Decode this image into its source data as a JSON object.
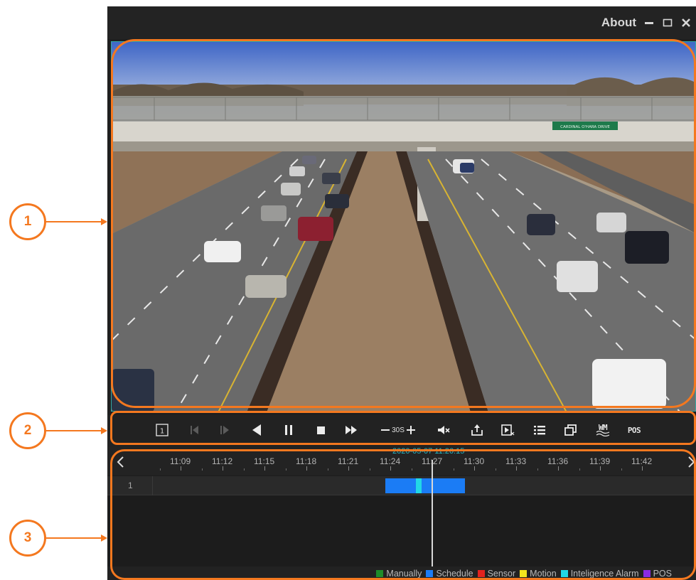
{
  "window": {
    "about_label": "About",
    "controls": [
      "minimize-icon",
      "maximize-icon",
      "close-icon"
    ]
  },
  "video": {
    "sign_text": "CARDINAL O'HARA DRIVE"
  },
  "toolbar": {
    "buttons": [
      {
        "name": "single-window-icon",
        "glyph": "1"
      },
      {
        "name": "frame-back-icon"
      },
      {
        "name": "frame-forward-icon"
      },
      {
        "name": "reverse-play-icon"
      },
      {
        "name": "pause-icon"
      },
      {
        "name": "stop-icon"
      },
      {
        "name": "fast-forward-icon"
      },
      {
        "name": "speed-minus-icon"
      },
      {
        "name": "speed-plus-icon"
      },
      {
        "name": "mute-icon"
      },
      {
        "name": "export-icon"
      },
      {
        "name": "clip-icon"
      },
      {
        "name": "list-icon"
      },
      {
        "name": "window-layout-icon"
      },
      {
        "name": "watermark-icon"
      },
      {
        "name": "pos-icon"
      }
    ],
    "speed_value": "30S",
    "watermark_text": "WM",
    "pos_text": "POS"
  },
  "timeline": {
    "current_time": "2020-05-07 11:26:15",
    "ticks": [
      "11:09",
      "11:12",
      "11:15",
      "11:18",
      "11:21",
      "11:24",
      "11:27",
      "11:30",
      "11:33",
      "11:36",
      "11:39",
      "11:42"
    ],
    "channel": "1",
    "recordings": [
      {
        "type": "Schedule",
        "start": "11:23:40",
        "end": "11:25:50"
      },
      {
        "type": "Inteligence Alarm",
        "start": "11:25:50",
        "end": "11:26:15"
      },
      {
        "type": "Schedule",
        "start": "11:26:15",
        "end": "11:29:20"
      }
    ],
    "legend": [
      {
        "label": "Manually",
        "color": "#1e8c2a"
      },
      {
        "label": "Schedule",
        "color": "#1b7cf5"
      },
      {
        "label": "Sensor",
        "color": "#e2231f"
      },
      {
        "label": "Motion",
        "color": "#f2e51d"
      },
      {
        "label": "Inteligence Alarm",
        "color": "#22d8e6"
      },
      {
        "label": "POS",
        "color": "#8a2be2"
      }
    ]
  },
  "callouts": [
    "1",
    "2",
    "3"
  ]
}
